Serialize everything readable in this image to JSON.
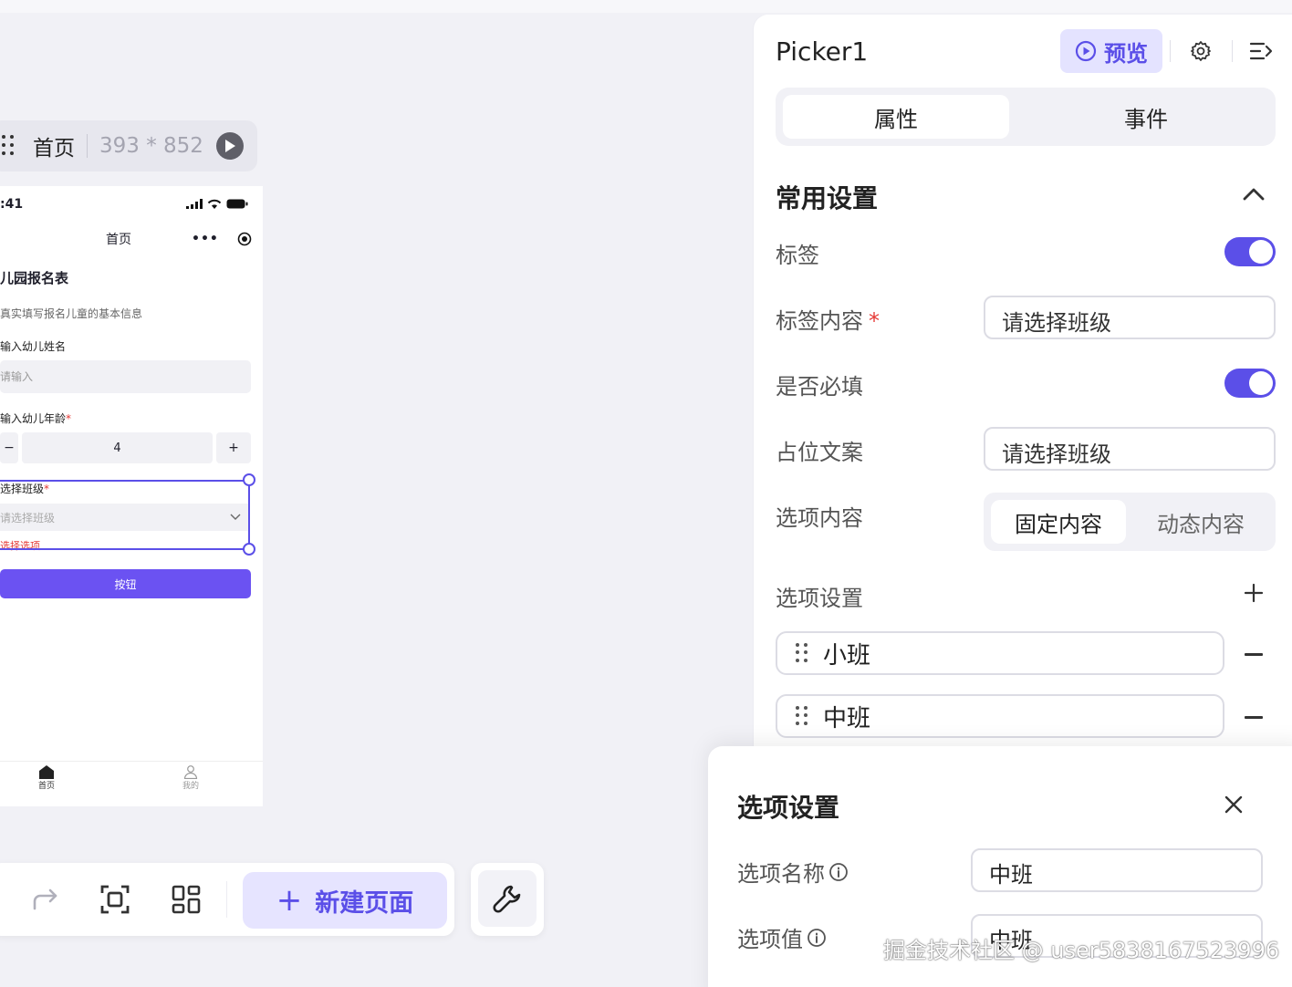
{
  "canvas": {
    "page_bar": {
      "name": "首页",
      "size": "393 * 852"
    },
    "phone": {
      "status_time": ":41",
      "nav_title": "首页",
      "form_title": "儿园报名表",
      "form_desc": "真实填写报名儿童的基本信息",
      "name_label": "输入幼儿姓名",
      "name_placeholder": "请输入",
      "age_label": "输入幼儿年龄",
      "age_required": "*",
      "age_minus": "−",
      "age_value": "4",
      "age_plus": "+",
      "class_label": "选择班级",
      "class_required": "*",
      "class_placeholder": "请选择班级",
      "class_error": "选择选项",
      "submit_label": "按钮",
      "tabs": [
        {
          "label": "首页"
        },
        {
          "label": "我的"
        }
      ]
    }
  },
  "toolbar": {
    "new_page_label": "新建页面"
  },
  "panel": {
    "title": "Picker1",
    "preview_label": "预览",
    "tabs": [
      {
        "label": "属性"
      },
      {
        "label": "事件"
      }
    ],
    "section_title": "常用设置",
    "rows": {
      "label_toggle": "标签",
      "label_content": "标签内容",
      "label_content_required": "*",
      "label_content_value": "请选择班级",
      "required_toggle": "是否必填",
      "placeholder": "占位文案",
      "placeholder_value": "请选择班级",
      "option_content": "选项内容",
      "option_content_tabs": [
        {
          "label": "固定内容"
        },
        {
          "label": "动态内容"
        }
      ],
      "option_settings": "选项设置"
    },
    "options": [
      {
        "label": "小班"
      },
      {
        "label": "中班"
      }
    ]
  },
  "popup": {
    "title": "选项设置",
    "name_label": "选项名称",
    "name_value": "中班",
    "value_label": "选项值",
    "value_value": "中班"
  },
  "watermark": "掘金技术社区 @ user5838167523996",
  "colors": {
    "accent": "#5b4fe8",
    "accent_light": "#e4e3ff",
    "danger": "#e53935"
  }
}
